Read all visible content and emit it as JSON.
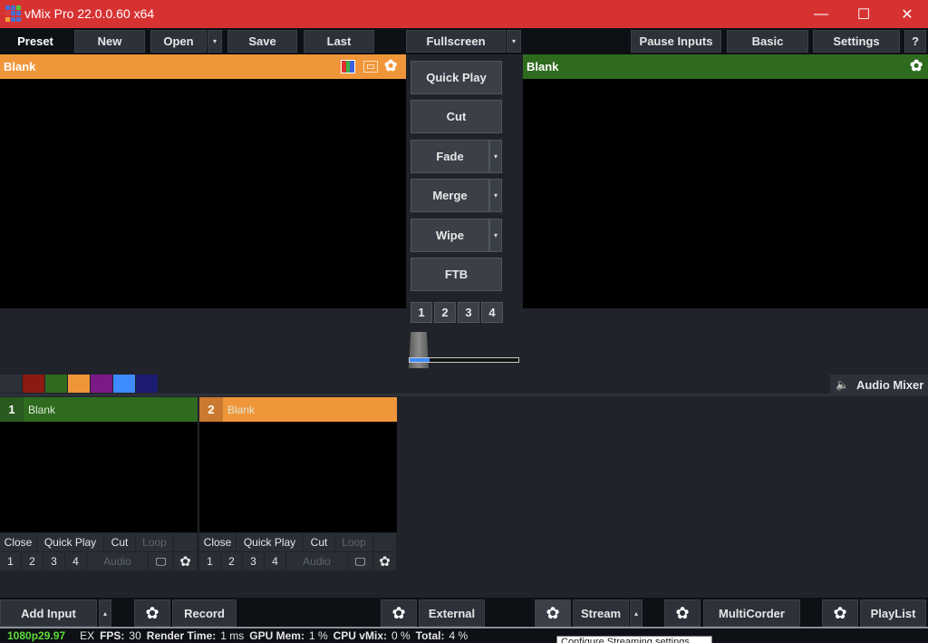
{
  "window": {
    "title": "vMix Pro 22.0.0.60 x64",
    "logo_colors": [
      "#4a6fd1",
      "#4a6fd1",
      "#5bc236",
      "#d64040",
      "#4a6fd1",
      "#4a6fd1",
      "#f3a23a",
      "#4a6fd1",
      "#4a6fd1"
    ],
    "controls": {
      "minimize": "—",
      "maximize": "☐",
      "close": "✕"
    }
  },
  "toolbar": {
    "preset": "Preset",
    "new": "New",
    "open": "Open",
    "save": "Save",
    "last": "Last",
    "fullscreen": "Fullscreen",
    "pause_inputs": "Pause Inputs",
    "basic": "Basic",
    "settings": "Settings",
    "help": "?",
    "dropdown_glyph": "▾"
  },
  "preview": {
    "title": "Blank",
    "color": "#f0963a"
  },
  "output": {
    "title": "Blank",
    "color": "#2e6b1e"
  },
  "transitions": {
    "quick_play": "Quick Play",
    "cut": "Cut",
    "fade": "Fade",
    "merge": "Merge",
    "wipe": "Wipe",
    "ftb": "FTB",
    "numbers": [
      "1",
      "2",
      "3",
      "4"
    ],
    "tbar_position_percent": 18
  },
  "color_tags": [
    "#2c313a",
    "#8b1a12",
    "#2e6b1e",
    "#f0963a",
    "#7b1a86",
    "#3d8bff",
    "#1c1c72"
  ],
  "audio_mixer": {
    "label": "Audio Mixer",
    "icon": "🔈"
  },
  "inputs": [
    {
      "number": "1",
      "name": "Blank",
      "color": "#2e6b1e",
      "num_color": "#295a1e",
      "buttons": {
        "close": "Close",
        "quick_play": "Quick Play",
        "cut": "Cut",
        "loop": "Loop",
        "audio": "Audio"
      },
      "overlays": [
        "1",
        "2",
        "3",
        "4"
      ]
    },
    {
      "number": "2",
      "name": "Blank",
      "color": "#f0963a",
      "num_color": "#c97a30",
      "buttons": {
        "close": "Close",
        "quick_play": "Quick Play",
        "cut": "Cut",
        "loop": "Loop",
        "audio": "Audio"
      },
      "overlays": [
        "1",
        "2",
        "3",
        "4"
      ]
    }
  ],
  "bottom_bar": {
    "add_input": "Add Input",
    "record": "Record",
    "external": "External",
    "stream": "Stream",
    "multicorder": "MultiCorder",
    "playlist": "PlayList",
    "dropdown_glyph": "▴",
    "gear_glyph": "✿"
  },
  "status": {
    "resolution": "1080p29.97",
    "ex": "EX",
    "fps_label": "FPS:",
    "fps": "30",
    "render_label": "Render Time:",
    "render": "1 ms",
    "gpu_label": "GPU Mem:",
    "gpu": "1 %",
    "cpu_label": "CPU vMix:",
    "cpu": "0 %",
    "total_label": "Total:",
    "total": "4 %"
  },
  "tooltip": "Configure Streaming settings"
}
